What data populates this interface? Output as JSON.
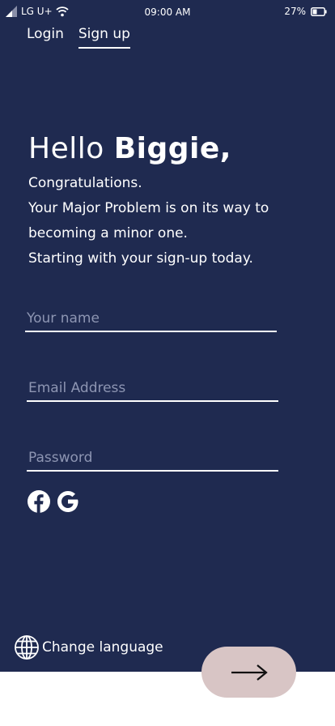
{
  "status_bar": {
    "carrier": "LG U+",
    "time": "09:00 AM",
    "battery": "27%",
    "icons": [
      "signal-icon",
      "wifi-icon",
      "battery-icon"
    ]
  },
  "tabs": [
    {
      "label": "Login",
      "active": false
    },
    {
      "label": "Sign up",
      "active": true
    }
  ],
  "greeting": {
    "hello": "Hello",
    "name": "Biggie,"
  },
  "message": {
    "line1": "Congratulations.",
    "line2": "Your Major Problem is on its way to",
    "line3": "becoming a minor one.",
    "line4": "Starting with your sign-up today."
  },
  "form": {
    "name_placeholder": "Your name",
    "email_placeholder": "Email Address",
    "password_placeholder": "Password",
    "name_value": "",
    "email_value": "",
    "password_value": ""
  },
  "social": [
    "facebook-icon",
    "google-icon"
  ],
  "language": {
    "label": "Change language",
    "icon": "globe-icon"
  },
  "next": {
    "icon": "arrow-right-icon"
  },
  "colors": {
    "background": "#1f2a50",
    "text": "#ffffff",
    "placeholder": "#8d95b2",
    "next_button": "#d8c5c5"
  }
}
